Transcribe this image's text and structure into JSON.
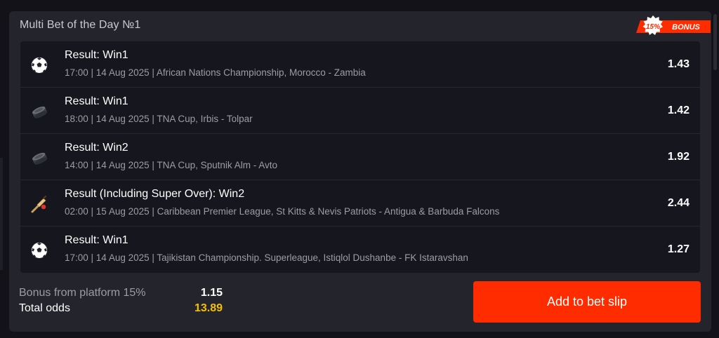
{
  "card": {
    "title": "Multi Bet of the Day №1",
    "badge": {
      "percent": "15%",
      "label": "BONUS",
      "color": "#ff2c00"
    }
  },
  "bets": [
    {
      "sport_icon": "soccer-ball-icon",
      "title": "Result: Win1",
      "meta": "17:00 | 14 Aug 2025 | African Nations Championship, Morocco - Zambia",
      "odds": "1.43"
    },
    {
      "sport_icon": "hockey-puck-icon",
      "title": "Result: Win1",
      "meta": "18:00 | 14 Aug 2025 | TNA Cup, Irbis - Tolpar",
      "odds": "1.42"
    },
    {
      "sport_icon": "hockey-puck-icon",
      "title": "Result: Win2",
      "meta": "14:00 | 14 Aug 2025 | TNA Cup, Sputnik Alm - Avto",
      "odds": "1.92"
    },
    {
      "sport_icon": "cricket-bat-icon",
      "title": "Result (Including Super Over): Win2",
      "meta": "02:00 | 15 Aug 2025 | Caribbean Premier League, St Kitts & Nevis Patriots - Antigua & Barbuda Falcons",
      "odds": "2.44"
    },
    {
      "sport_icon": "soccer-ball-icon",
      "title": "Result: Win1",
      "meta": "17:00 | 14 Aug 2025 | Tajikistan Championship. Superleague, Istiqlol Dushanbe - FK Istaravshan",
      "odds": "1.27"
    }
  ],
  "summary": {
    "bonus_label": "Bonus from platform 15%",
    "bonus_value": "1.15",
    "total_label": "Total odds",
    "total_value": "13.89",
    "total_color": "#f5c000"
  },
  "actions": {
    "add_label": "Add to bet slip",
    "add_color": "#ff2c00"
  }
}
